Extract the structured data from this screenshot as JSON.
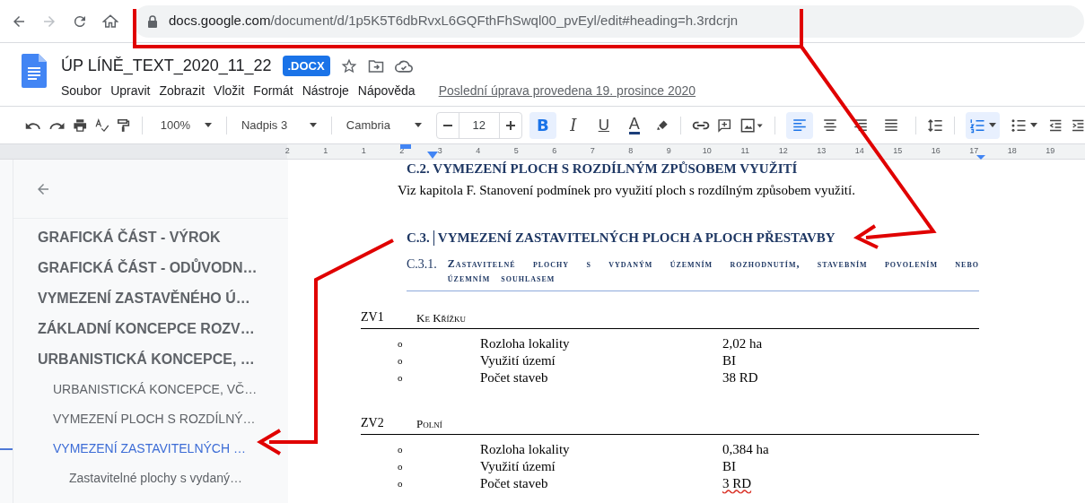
{
  "browser": {
    "url_host": "docs.google.com",
    "url_path": "/document/d/1p5K5T6dbRvxL6GQFthFhSwql00_pvEyl/edit#heading=h.3rdcrjn"
  },
  "document": {
    "title": "ÚP LÍNĚ_TEXT_2020_11_22",
    "badge": ".DOCX",
    "last_edit": "Poslední úprava provedena 19. prosince 2020"
  },
  "menu": [
    "Soubor",
    "Upravit",
    "Zobrazit",
    "Vložit",
    "Formát",
    "Nástroje",
    "Nápověda"
  ],
  "toolbar": {
    "zoom": "100%",
    "style": "Nadpis 3",
    "font": "Cambria",
    "font_size": "12",
    "buttons": [
      {
        "kind": "bold",
        "label": "B",
        "selected": true
      },
      {
        "kind": "italic",
        "label": "I",
        "selected": false
      },
      {
        "kind": "underline",
        "label": "U",
        "selected": false
      },
      {
        "kind": "color",
        "label": "A",
        "selected": false
      }
    ],
    "align": [
      {
        "kind": "left",
        "selected": true
      },
      {
        "kind": "center",
        "selected": false
      },
      {
        "kind": "right",
        "selected": false
      },
      {
        "kind": "justify",
        "selected": false
      }
    ],
    "lists": [
      {
        "kind": "numbered",
        "selected": true
      },
      {
        "kind": "bulleted",
        "selected": false
      }
    ]
  },
  "ruler": [
    "2",
    "1",
    "1",
    "2",
    "3",
    "4",
    "5",
    "6",
    "7",
    "8",
    "9",
    "10",
    "11",
    "12",
    "13",
    "14",
    "15",
    "16",
    "17",
    "18",
    "19"
  ],
  "outline": [
    {
      "label": "GRAFICKÁ ČÁST - VÝROK",
      "selected": false
    },
    {
      "label": "GRAFICKÁ ČÁST - ODŮVODN…",
      "selected": false
    },
    {
      "label": "VYMEZENÍ ZASTAVĚNÉHO Ú…",
      "selected": false
    },
    {
      "label": "ZÁKLADNÍ KONCEPCE ROZV…",
      "selected": false
    },
    {
      "label": "URBANISTICKÁ KONCEPCE, …",
      "selected": false,
      "children": [
        {
          "label": "URBANISTICKÁ KONCEPCE, VČ…",
          "selected": false
        },
        {
          "label": "VYMEZENÍ PLOCH S ROZDÍLNÝ…",
          "selected": false
        },
        {
          "label": "VYMEZENÍ ZASTAVITELNÝCH …",
          "selected": true,
          "children": [
            {
              "label": "Zastavitelné plochy s vydaný…",
              "selected": false
            }
          ]
        }
      ]
    }
  ],
  "content": {
    "h2": "C.2. VYMEZENÍ PLOCH S ROZDÍLNÝM ZPŮSOBEM VYUŽITÍ",
    "paragraph": "Viz kapitola F. Stanovení podmínek pro využití ploch s rozdílným způsobem využití.",
    "h3_number": "C.3.",
    "h3": "VYMEZENÍ ZASTAVITELNÝCH PLOCH A PLOCH PŘESTAVBY",
    "h4_number": "C.3.1.",
    "h4": "Zastavitelné plochy s vydaným územním rozhodnutím, stavebním povolením nebo územním souhlasem",
    "areas": [
      {
        "code": "ZV1",
        "name": "Ke Křížku",
        "rows": [
          {
            "bullet": "o",
            "label": "Rozloha lokality",
            "value": "2,02 ha"
          },
          {
            "bullet": "o",
            "label": "Využití území",
            "value": "BI"
          },
          {
            "bullet": "o",
            "label": "Počet staveb",
            "value": "38 RD"
          }
        ]
      },
      {
        "code": "ZV2",
        "name": "Polní",
        "rows": [
          {
            "bullet": "o",
            "label": "Rozloha lokality",
            "value": "0,384 ha"
          },
          {
            "bullet": "o",
            "label": "Využití území",
            "value": "BI"
          },
          {
            "bullet": "o",
            "label": "Počet staveb",
            "value": "3 RD",
            "misspelled": true
          }
        ]
      }
    ]
  }
}
